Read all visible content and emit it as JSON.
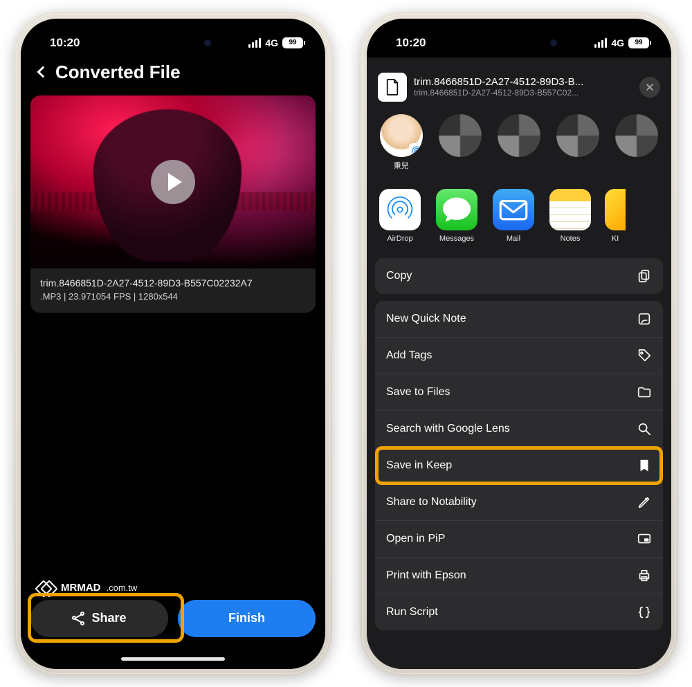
{
  "status": {
    "time": "10:20",
    "network": "4G",
    "battery": "99"
  },
  "left": {
    "title": "Converted File",
    "filename": "trim.8466851D-2A27-4512-89D3-B557C02232A7",
    "meta": ".MP3 | 23.971054 FPS | 1280x544",
    "share": "Share",
    "finish": "Finish",
    "watermark_brand": "MRMAD",
    "watermark_domain": ".com.tw"
  },
  "right": {
    "file_title": "trim.8466851D-2A27-4512-89D3-B...",
    "file_sub": "trim.8466851D-2A27-4512-89D3-B557C02...",
    "person_name": "秉兒",
    "apps": {
      "airdrop": "AirDrop",
      "messages": "Messages",
      "mail": "Mail",
      "notes": "Notes",
      "km": "KI"
    },
    "actions": {
      "copy": "Copy",
      "new_quick_note": "New Quick Note",
      "add_tags": "Add Tags",
      "save_to_files": "Save to Files",
      "search_google_lens": "Search with Google Lens",
      "save_in_keep": "Save in Keep",
      "share_notability": "Share to Notability",
      "open_pip": "Open in PiP",
      "print_epson": "Print with Epson",
      "run_script": "Run Script"
    }
  }
}
